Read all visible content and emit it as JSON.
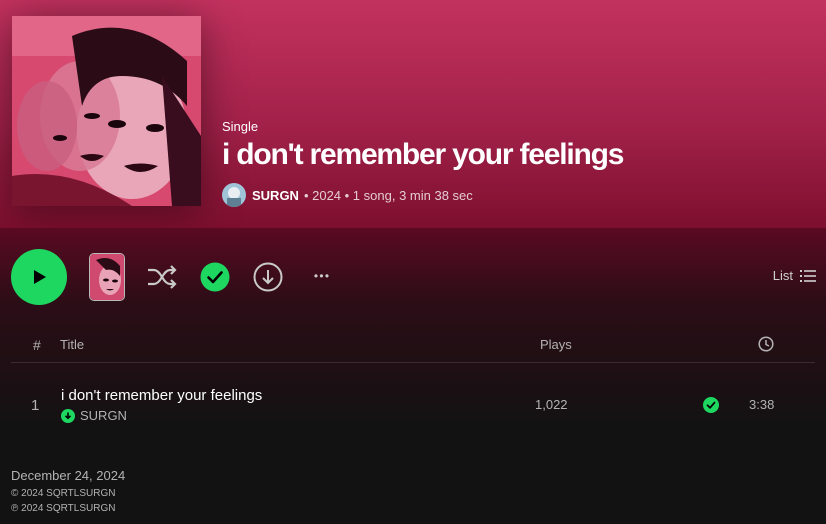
{
  "album": {
    "type_label": "Single",
    "title": "i don't remember your feelings",
    "artist": "SURGN",
    "meta": "• 2024 • 1 song, 3 min 38 sec"
  },
  "actions": {
    "list_label": "List",
    "more_label": "• • •"
  },
  "table": {
    "headers": {
      "num": "#",
      "title": "Title",
      "plays": "Plays"
    },
    "tracks": [
      {
        "num": "1",
        "title": "i don't remember your feelings",
        "artist": "SURGN",
        "plays": "1,022",
        "duration": "3:38"
      }
    ]
  },
  "footer": {
    "release_date": "December 24, 2024",
    "copyright": "© 2024 SQRTLSURGN",
    "phonogram": "℗ 2024 SQRTLSURGN"
  },
  "colors": {
    "accent": "#1ed760",
    "hero": "#b12a52",
    "background": "#121212"
  },
  "icons": [
    "play-icon",
    "shuffle-icon",
    "saved-check-icon",
    "download-icon",
    "more-icon",
    "list-icon",
    "clock-icon"
  ]
}
